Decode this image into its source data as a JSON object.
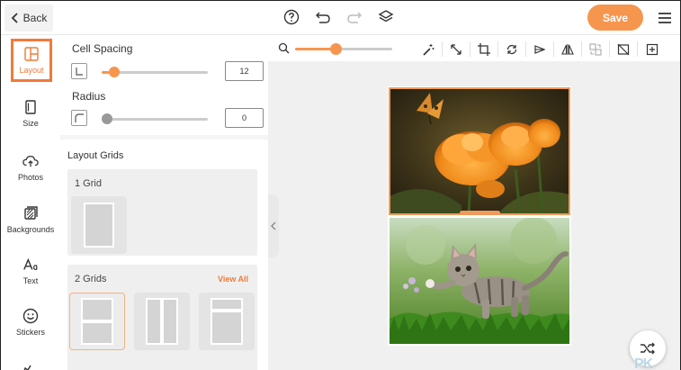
{
  "topbar": {
    "back_label": "Back",
    "save_label": "Save",
    "icons": [
      "help-icon",
      "undo-icon",
      "redo-icon",
      "layers-icon",
      "menu-icon"
    ]
  },
  "rail": {
    "items": [
      {
        "label": "Layout",
        "icon": "layout-icon",
        "active": true
      },
      {
        "label": "Size",
        "icon": "size-icon"
      },
      {
        "label": "Photos",
        "icon": "cloud-upload-icon"
      },
      {
        "label": "Backgrounds",
        "icon": "backgrounds-icon"
      },
      {
        "label": "Text",
        "icon": "text-icon"
      },
      {
        "label": "Stickers",
        "icon": "smiley-icon"
      }
    ]
  },
  "panel": {
    "cell_spacing": {
      "label": "Cell Spacing",
      "value": "12",
      "level": 0.12
    },
    "radius": {
      "label": "Radius",
      "value": "0",
      "level": 0
    },
    "layout_grids_title": "Layout Grids",
    "one_grid": {
      "label": "1 Grid"
    },
    "two_grids": {
      "label": "2 Grids",
      "view_all": "View All"
    }
  },
  "canvas": {
    "zoom_level": 0.42,
    "tools": [
      "magic-wand-icon",
      "resize-icon",
      "crop-icon",
      "rotate-icon",
      "flip-icon",
      "mirror-icon",
      "replace-icon",
      "remove-image-icon",
      "add-icon"
    ]
  },
  "colors": {
    "accent": "#f6964e",
    "active_border": "#f07a3a"
  },
  "watermark": "PK"
}
